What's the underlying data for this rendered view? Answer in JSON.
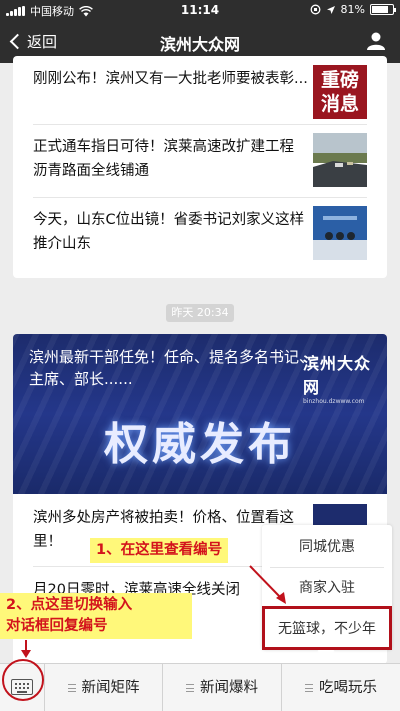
{
  "status_bar": {
    "carrier": "中国移动",
    "time": "11:14",
    "battery": "81%",
    "battery_level": 0.81
  },
  "nav": {
    "back_label": "返回",
    "title": "滨州大众网",
    "profile_icon": "person-icon"
  },
  "top_articles": [
    {
      "title": "刚刚公布！滨州又有一大批老师要被表彰...",
      "thumb_lines": [
        "重磅",
        "消息"
      ]
    },
    {
      "title": "正式通车指日可待！滨莱高速改扩建工程沥青路面全线铺通",
      "thumb_icon": "highway-photo-icon"
    },
    {
      "title": "今天，山东C位出镜！省委书记刘家义这样推介山东",
      "thumb_icon": "press-conference-photo-icon"
    }
  ],
  "timestamp": "昨天 20:34",
  "banner": {
    "headline": "滨州最新干部任免！任命、提名多名书记、主席、部长......",
    "big_text": "权威发布",
    "logo_text": "滨州大众网",
    "logo_url": "binzhou.dzwww.com"
  },
  "bottom_articles": [
    {
      "title": "滨州多处房产将被拍卖！价格、位置看这里！"
    },
    {
      "title": "月20日零时，滨莱高速全线关闭"
    }
  ],
  "popup_menu": {
    "items": [
      "同城优惠",
      "商家入驻",
      "无篮球，不少年"
    ]
  },
  "annotations": {
    "step1": "1、在这里查看编号",
    "step2_line1": "2、点这里切换输入",
    "step2_line2": "对话框回复编号"
  },
  "menu_bar": {
    "keyboard_icon": "keyboard-icon",
    "items": [
      "新闻矩阵",
      "新闻爆料",
      "吃喝玩乐"
    ]
  },
  "colors": {
    "nav_bg": "#2e2e2e",
    "annotation_red": "#b1101a",
    "annotation_yellow": "#fff87a",
    "banner_blue": "#24378a"
  }
}
